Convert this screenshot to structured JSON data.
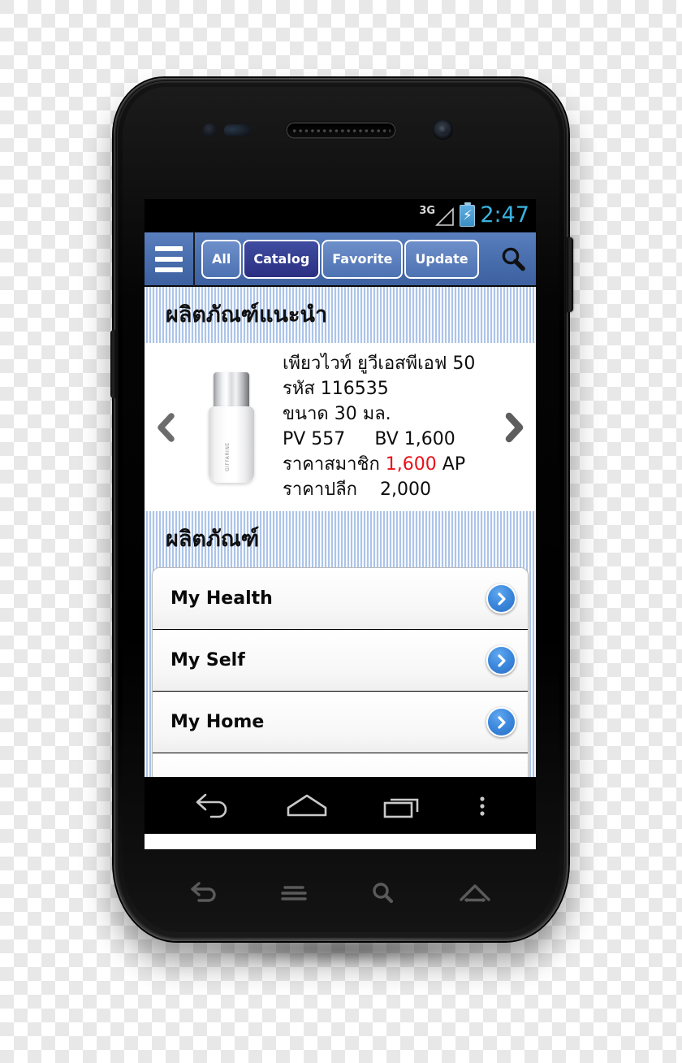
{
  "status_bar": {
    "network_type": "3G",
    "battery_state": "charging",
    "battery_icon": "battery-charging-icon",
    "signal_icon": "signal-bars-icon",
    "clock": "2:47"
  },
  "toolbar": {
    "menu_icon": "hamburger-menu-icon",
    "search_icon": "search-icon",
    "tabs": [
      {
        "label": "All",
        "selected": false
      },
      {
        "label": "Catalog",
        "selected": true
      },
      {
        "label": "Favorite",
        "selected": false
      },
      {
        "label": "Update",
        "selected": false
      }
    ]
  },
  "featured_section": {
    "header": "ผลิตภัณฑ์แนะนำ",
    "prev_icon": "chevron-left-icon",
    "next_icon": "chevron-right-icon",
    "product": {
      "name": "เพียวไวท์ ยูวีเอสพีเอฟ 50",
      "code_line": "รหัส 116535",
      "size_line": "ขนาด 30 มล.",
      "pv_label": "PV 557",
      "bv_label": "BV 1,600",
      "member_price_label": "ราคาสมาชิก",
      "member_price_value": "1,600",
      "member_price_unit": "AP",
      "retail_price_label": "ราคาปลีก",
      "retail_price_value": "2,000",
      "image_alt": "pure-white-uv-spf50-bottle",
      "bottle_label_text": "GIFFARINE"
    }
  },
  "category_section": {
    "header": "ผลิตภัณฑ์",
    "items": [
      {
        "label": "My Health",
        "chevron": "chevron-right-circle-icon"
      },
      {
        "label": "My Self",
        "chevron": "chevron-right-circle-icon"
      },
      {
        "label": "My Home",
        "chevron": "chevron-right-circle-icon"
      }
    ]
  },
  "android_nav_bar": {
    "keys": [
      {
        "name": "back-icon"
      },
      {
        "name": "home-icon"
      },
      {
        "name": "recents-icon"
      },
      {
        "name": "overflow-menu-icon"
      }
    ]
  },
  "capacitive_keys": [
    {
      "name": "back-icon"
    },
    {
      "name": "menu-icon"
    },
    {
      "name": "search-icon"
    },
    {
      "name": "home-icon"
    }
  ],
  "colors": {
    "toolbar_blue": "#4a6fae",
    "tab_selected_blue": "#2b2f82",
    "stripe_blue": "#c7d8f2",
    "price_red": "#e8111b",
    "clock_blue": "#3ab3e0",
    "disclosure_blue": "#3d8ade"
  }
}
